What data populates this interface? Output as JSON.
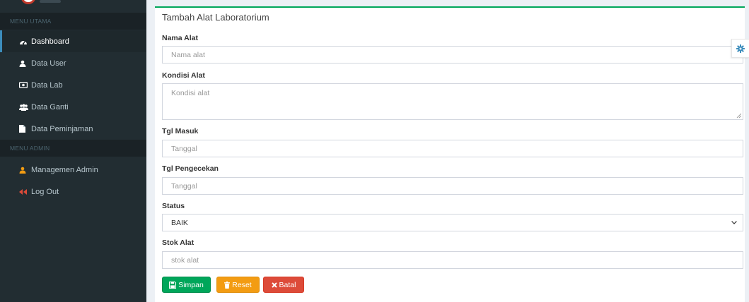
{
  "sidebar": {
    "headers": [
      "MENU UTAMA",
      "MENU ADMIN"
    ],
    "items": [
      {
        "label": "Dashboard",
        "icon": "dashboard-icon",
        "active": true
      },
      {
        "label": "Data User",
        "icon": "user-icon"
      },
      {
        "label": "Data Lab",
        "icon": "lab-icon"
      },
      {
        "label": "Data Ganti",
        "icon": "users-icon"
      },
      {
        "label": "Data Peminjaman",
        "icon": "file-icon"
      },
      {
        "label": "Managemen Admin",
        "icon": "admin-user-icon"
      },
      {
        "label": "Log Out",
        "icon": "backward-icon"
      }
    ]
  },
  "form": {
    "title": "Tambah Alat Laboratorium",
    "nama_alat": {
      "label": "Nama Alat",
      "placeholder": "Nama alat"
    },
    "kondisi_alat": {
      "label": "Kondisi Alat",
      "placeholder": "Kondisi alat"
    },
    "tgl_masuk": {
      "label": "Tgl Masuk",
      "placeholder": "Tanggal"
    },
    "tgl_pengecekan": {
      "label": "Tgl Pengecekan",
      "placeholder": "Tanggal"
    },
    "status": {
      "label": "Status",
      "value": "BAIK"
    },
    "stok_alat": {
      "label": "Stok Alat",
      "placeholder": "stok alat"
    }
  },
  "buttons": {
    "simpan": "Simpan",
    "reset": "Reset",
    "batal": "Batal"
  },
  "colors": {
    "sidebar_bg": "#222d32",
    "accent_green": "#00a65a",
    "accent_orange": "#f39c12",
    "accent_red": "#dd4b39",
    "active_border": "#3c8dbc",
    "gear_blue": "#3c8dbc"
  }
}
